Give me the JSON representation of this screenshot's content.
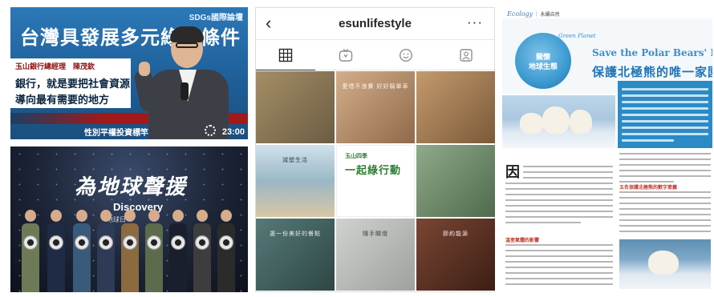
{
  "left_panel": {
    "video": {
      "backdrop_title": "台灣具發展多元綠能條件",
      "forum_tag": "SDGs國際論壇",
      "sub_line": "玉山銀行總經理 陳茂欽",
      "speaker_line": "玉山銀行總經理　陳茂欽",
      "quote_line_1": "銀行，就是要把社會資源",
      "quote_line_2": "導向最有需要的地方",
      "bottom_strip": "性別平權投資標竿",
      "duration": "23:00"
    },
    "event": {
      "banner_title": "為地球聲援",
      "brand": "Discovery",
      "tagline": "地球日"
    }
  },
  "instagram": {
    "username": "esunlifestyle",
    "back_icon": "chevron-left-icon",
    "more_icon": "more-icon",
    "tabs": [
      {
        "name": "grid-icon"
      },
      {
        "name": "igtv-icon"
      },
      {
        "name": "face-icon"
      },
      {
        "name": "tagged-icon"
      }
    ],
    "posts": [
      {
        "bg": "#8a7a5c",
        "text": ""
      },
      {
        "bg": "#c7a07e",
        "text": "愛惜不浪費 好好騎單車"
      },
      {
        "bg": "#b28a5e",
        "text": ""
      },
      {
        "bg": "#9cb7c6",
        "text": "減塑生活"
      },
      {
        "bg": "#ffffff",
        "text": "",
        "green_small": "玉山四季",
        "green_title": "一起綠行動"
      },
      {
        "bg": "#6e8a6a",
        "text": ""
      },
      {
        "bg": "#4c6d6a",
        "text": "選一份美好的餐點"
      },
      {
        "bg": "#bfc2bf",
        "text": "隨手關燈"
      },
      {
        "bg": "#6b3c2c",
        "text": "節約能源"
      }
    ]
  },
  "magazine": {
    "section_label": "Ecology",
    "section_tag": "｜ 永續自然",
    "globe_label_1": "關懷",
    "globe_label_2": "地球生態",
    "en_small": "Green Planet",
    "headline_en": "Save the Polar Bears' Home",
    "headline_zh": "保護北極熊的唯一家園",
    "dropcap": "因",
    "subhead_1": "溫室氣體的影響",
    "subhead_2": "五名保護北極熊的數字意義"
  }
}
